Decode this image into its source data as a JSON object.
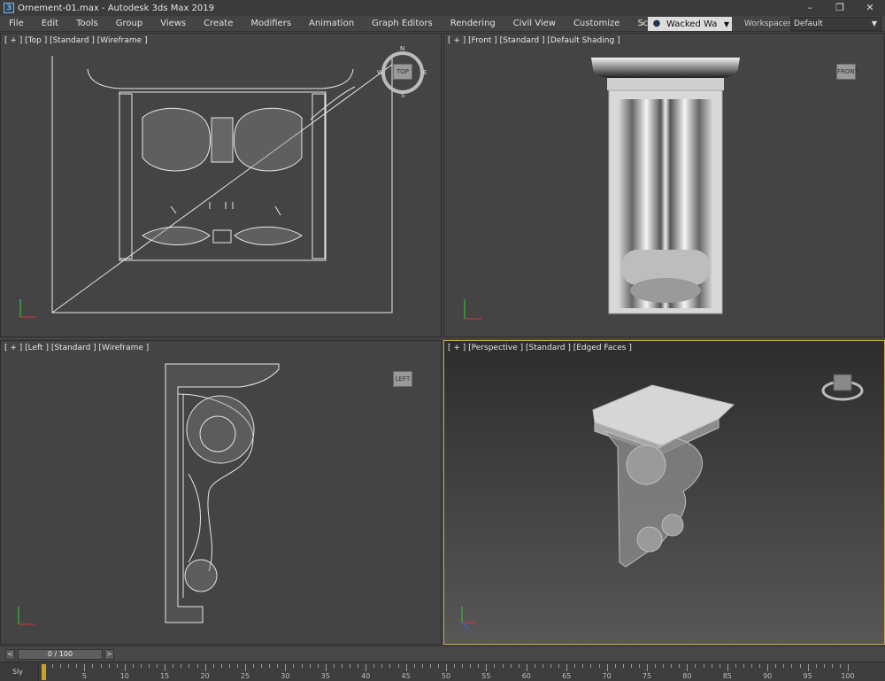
{
  "window": {
    "icon": "3ds-max-icon",
    "title": "Ornement-01.max - Autodesk 3ds Max 2019",
    "minimize": "–",
    "maximize": "❐",
    "close": "✕"
  },
  "menu": {
    "items": [
      "File",
      "Edit",
      "Tools",
      "Group",
      "Views",
      "Create",
      "Modifiers",
      "Animation",
      "Graph Editors",
      "Rendering",
      "Civil View",
      "Customize",
      "Scripting"
    ],
    "overflow_arrow": "»",
    "user": "Wacked Wa",
    "workspaces_label": "Workspaces:",
    "workspace_value": "Default"
  },
  "viewports": {
    "top": {
      "label": "[ + ] [Top ] [Standard ] [Wireframe ]",
      "cube": "TOP",
      "compass": {
        "n": "N",
        "s": "S",
        "e": "E",
        "w": "W"
      }
    },
    "front": {
      "label": "[ + ] [Front ] [Standard ] [Default Shading ]",
      "cube": "FRONT"
    },
    "left": {
      "label": "[ + ] [Left ] [Standard ] [Wireframe ]",
      "cube": "LEFT"
    },
    "perspective": {
      "label": "[ + ] [Perspective ] [Standard ] [Edged Faces ]",
      "active": true
    }
  },
  "timeline": {
    "prev": "<",
    "next": ">",
    "frame_display": "0 / 100",
    "track_label": "Sly",
    "tick_labels": [
      "0",
      "5",
      "10",
      "15",
      "20",
      "25",
      "30",
      "35",
      "40",
      "45",
      "50",
      "55",
      "60",
      "65",
      "70",
      "75",
      "80",
      "85",
      "90",
      "95",
      "100"
    ]
  },
  "colors": {
    "active_border": "#c8a74a",
    "viewport_bg": "#444444",
    "time_cursor": "#c9a227"
  }
}
